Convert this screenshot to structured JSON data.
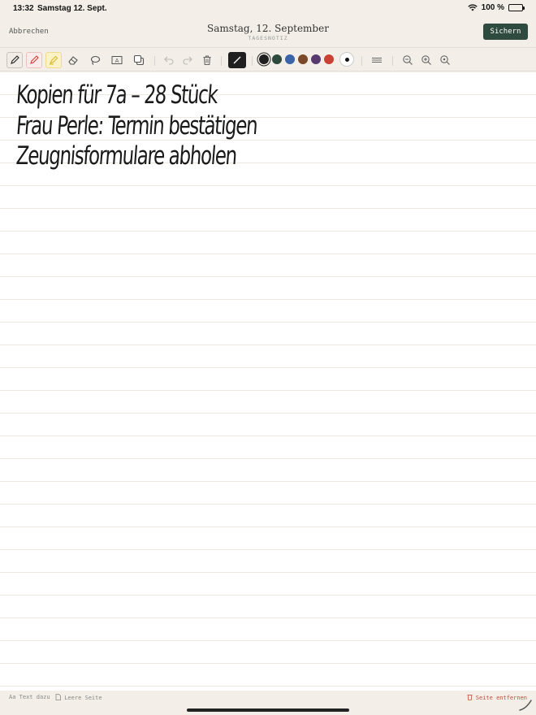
{
  "status_bar": {
    "time": "13:32",
    "date": "Samstag 12. Sept.",
    "battery": "100 %"
  },
  "header": {
    "cancel_label": "Abbrechen",
    "title": "Samstag, 12. September",
    "subtitle": "TAGESNOTIZ",
    "save_label": "Sichern"
  },
  "toolbar": {
    "tools": [
      "pen",
      "red-pen",
      "highlighter",
      "eraser",
      "lasso",
      "text-box",
      "shapes",
      "undo",
      "redo",
      "delete",
      "stroke-tool",
      "line-style",
      "zoom-out",
      "zoom-in",
      "zoom-fit"
    ],
    "colors": [
      "#1f1f1f",
      "#2e4a3d",
      "#3a63a8",
      "#7a4a2a",
      "#5a3a6e",
      "#c94034"
    ],
    "selected_color": "#1f1f1f",
    "accent": "#2f4a3e"
  },
  "note_lines": [
    "Kopien für 7a – 28 Stück",
    "Frau Perle: Termin bestätigen",
    "Zeugnisformulare abholen"
  ],
  "footer": {
    "text_label": "Text dazu",
    "text_icon": "Aa",
    "blank_page_label": "Leere Seite",
    "remove_page_label": "Seite entfernen"
  }
}
